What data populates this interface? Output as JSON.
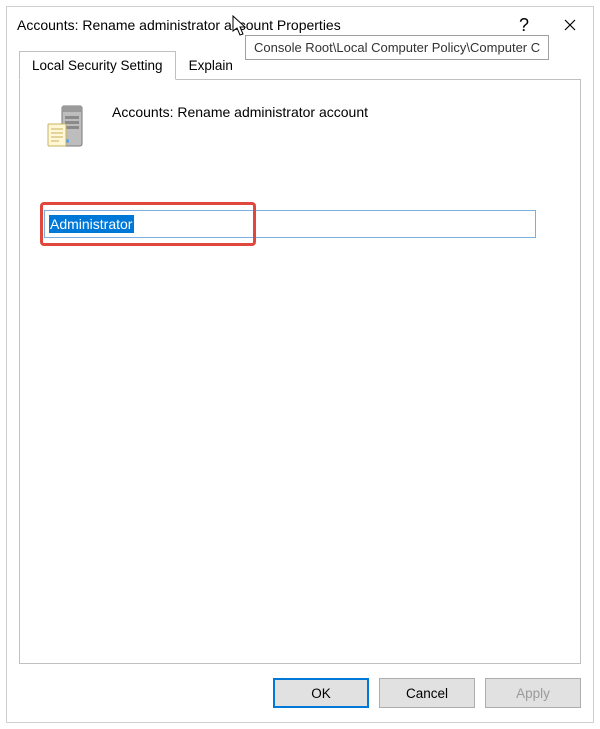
{
  "titlebar": {
    "title": "Accounts: Rename administrator account Properties",
    "help_label": "?",
    "close_label": "Close"
  },
  "tooltip": {
    "text": "Console Root\\Local Computer Policy\\Computer C"
  },
  "tabs": {
    "local_security_setting": "Local Security Setting",
    "explain": "Explain"
  },
  "panel": {
    "policy_title": "Accounts: Rename administrator account",
    "input_value": "Administrator"
  },
  "buttons": {
    "ok": "OK",
    "cancel": "Cancel",
    "apply": "Apply"
  }
}
